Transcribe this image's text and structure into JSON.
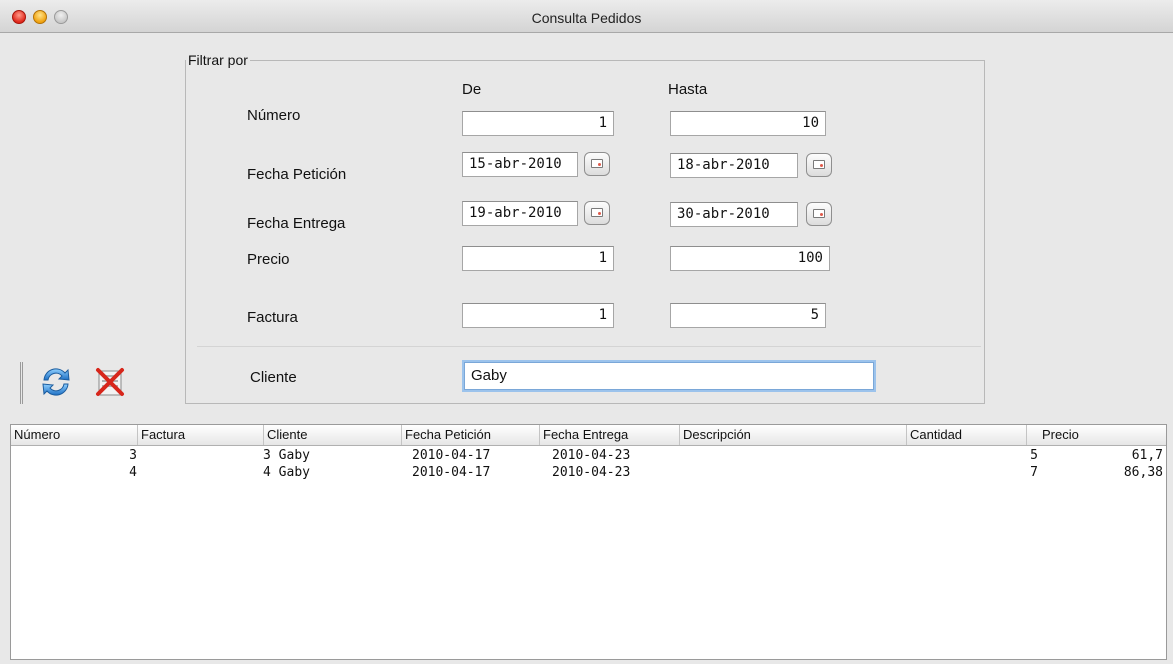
{
  "window": {
    "title": "Consulta Pedidos"
  },
  "filter": {
    "legend": "Filtrar por",
    "col_from": "De",
    "col_to": "Hasta",
    "numero": {
      "label": "Número",
      "from": "1",
      "to": "10"
    },
    "fecha_peticion": {
      "label": "Fecha Petición",
      "from": "15-abr-2010",
      "to": "18-abr-2010"
    },
    "fecha_entrega": {
      "label": "Fecha Entrega",
      "from": "19-abr-2010",
      "to": "30-abr-2010"
    },
    "precio": {
      "label": "Precio",
      "from": "1",
      "to": "100"
    },
    "factura": {
      "label": "Factura",
      "from": "1",
      "to": "5"
    },
    "cliente": {
      "label": "Cliente",
      "value": "Gaby"
    }
  },
  "toolbar": {
    "icons": [
      "refresh-icon",
      "clear-filter-icon"
    ]
  },
  "table": {
    "headers": [
      "Número",
      "Factura",
      "Cliente",
      "Fecha Petición",
      "Fecha Entrega",
      "Descripción",
      "Cantidad",
      "Precio"
    ],
    "rows": [
      {
        "numero": "3",
        "factura_cliente": "3 Gaby",
        "fecha_peticion": "2010-04-17",
        "fecha_entrega": "2010-04-23",
        "descripcion": "",
        "cantidad": "5",
        "precio": "61,7"
      },
      {
        "numero": "4",
        "factura_cliente": "4 Gaby",
        "fecha_peticion": "2010-04-17",
        "fecha_entrega": "2010-04-23",
        "descripcion": "",
        "cantidad": "7",
        "precio": "86,38"
      }
    ]
  },
  "colors": {
    "focus_ring": "#9cc3ec",
    "close": "#e0271b",
    "minimize": "#f0a20f"
  }
}
